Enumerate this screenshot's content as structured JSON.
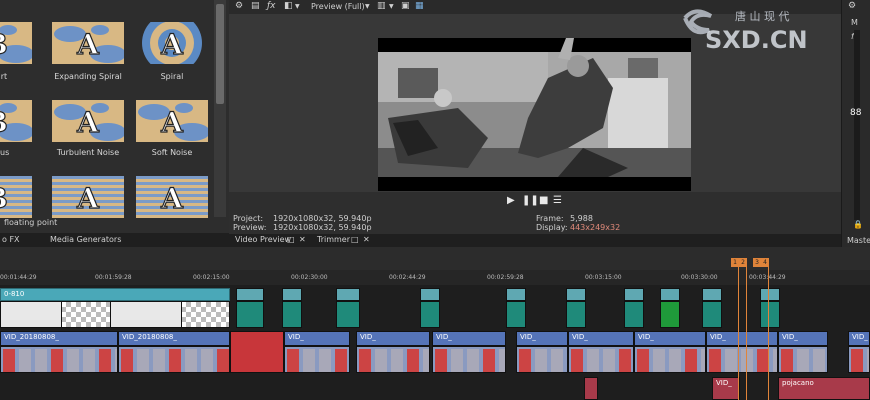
{
  "fx_panel": {
    "items": [
      {
        "label": "Heart",
        "glyph": "B"
      },
      {
        "label": "Expanding Spiral",
        "glyph": "A"
      },
      {
        "label": "Spiral",
        "glyph": "A"
      },
      {
        "label": "bulous",
        "glyph": "B"
      },
      {
        "label": "Turbulent Noise",
        "glyph": "A"
      },
      {
        "label": "Soft Noise",
        "glyph": "A"
      },
      {
        "label": "",
        "glyph": "B"
      },
      {
        "label": "",
        "glyph": "A"
      },
      {
        "label": "",
        "glyph": "A"
      }
    ],
    "status": "floating point",
    "tabs": [
      "o FX",
      "Media Generators"
    ]
  },
  "preview": {
    "toolbar_mode": "Preview (Full)",
    "project_label": "Project:",
    "project_value": "1920x1080x32, 59.940p",
    "preview_label": "Preview:",
    "preview_value": "1920x1080x32, 59.940p",
    "frame_label": "Frame:",
    "frame_value": "5,988",
    "display_label": "Display:",
    "display_value": "443x249x32",
    "tabs": [
      "Video Preview",
      "Trimmer"
    ]
  },
  "master": {
    "label_m": "M",
    "label_fx": "fx",
    "meter_value": "88",
    "bottom_label": "Maste"
  },
  "watermark": {
    "line1": "唐 山 现 代",
    "line2": "SXD.CN"
  },
  "timeline": {
    "ticks": [
      "00:01:44:29",
      "00:01:59:28",
      "00:02:15:00",
      "00:02:30:00",
      "00:02:44:29",
      "00:02:59:28",
      "00:03:15:00",
      "00:03:30:00",
      "00:03:44:29"
    ],
    "markers": [
      "1",
      "2",
      "3",
      "4"
    ],
    "video_track_clip": "0-810",
    "clips": [
      "VID_20180808_",
      "VID_20180808_",
      "VID_",
      "VID_",
      "VID_",
      "VID_",
      "VID_",
      "VID_",
      "VID_",
      "VID_",
      "VID_"
    ],
    "audio_clip": "pojacano",
    "audio_clip2": "VID_"
  },
  "colors": {
    "accent_orange": "#e0843a",
    "track_teal": "#4aa8b8",
    "clip_blue": "#5574b8",
    "audio_red": "#a83a4a",
    "display_value_color": "#e08a7a"
  }
}
